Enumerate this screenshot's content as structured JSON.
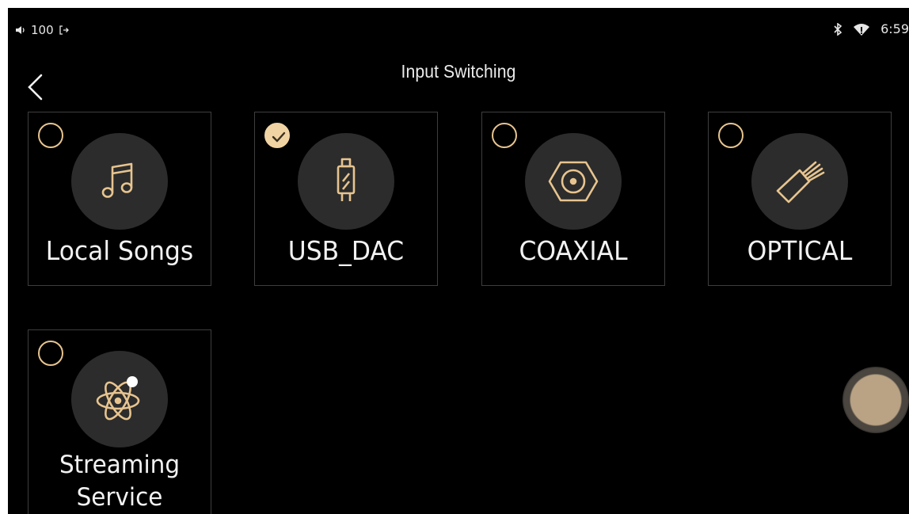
{
  "status_bar": {
    "volume": "100",
    "time": "6:59"
  },
  "header": {
    "title": "Input Switching"
  },
  "inputs": [
    {
      "label": "Local Songs",
      "selected": false,
      "icon": "music-note-icon"
    },
    {
      "label": "USB_DAC",
      "selected": true,
      "icon": "usb-plug-icon"
    },
    {
      "label": "COAXIAL",
      "selected": false,
      "icon": "coaxial-connector-icon"
    },
    {
      "label": "OPTICAL",
      "selected": false,
      "icon": "optical-fiber-icon"
    },
    {
      "label_line1": "Streaming",
      "label_line2": "Service",
      "selected": false,
      "icon": "atom-icon"
    }
  ],
  "colors": {
    "accent": "#e7c48f",
    "accent_fill": "#f1d4a3",
    "icon_circle": "#2c2c2c",
    "background": "#000000",
    "card_border": "#3e3e3e",
    "text": "#f2f2f2"
  }
}
